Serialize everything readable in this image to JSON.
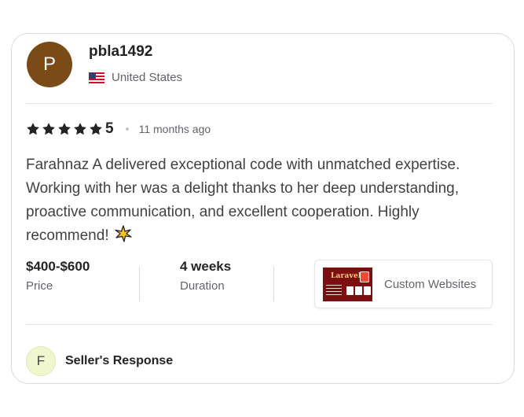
{
  "review": {
    "avatar_initial": "P",
    "username": "pbla1492",
    "country": "United States",
    "flag_icon": "us-flag-icon",
    "rating": "5",
    "stars_count": 5,
    "time_ago": "11 months ago",
    "text": "Farahnaz A delivered exceptional code with unmatched expertise. Working with her was a delight thanks to her deep understanding, proactive communication, and excellent cooperation. Highly recommend!",
    "emoji": "sparkle-icon"
  },
  "meta": {
    "price_value": "$400-$600",
    "price_label": "Price",
    "duration_value": "4 weeks",
    "duration_label": "Duration"
  },
  "project": {
    "thumb_title": "Laravel",
    "name": "Custom Websites"
  },
  "response": {
    "avatar_initial": "F",
    "label": "Seller's Response"
  },
  "colors": {
    "avatar_bg": "#7a4a17",
    "star": "#222325",
    "text": "#404145",
    "muted": "#62646a"
  }
}
